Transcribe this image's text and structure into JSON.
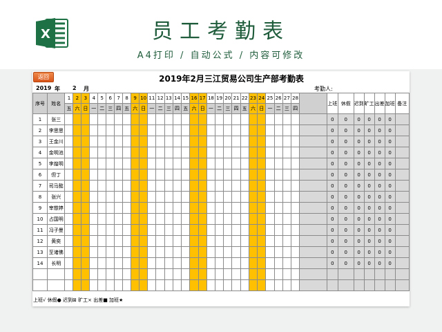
{
  "header": {
    "title": "员工考勤表",
    "subtitle": "A4打印 / 自动公式 / 内容可修改",
    "logo_icon": "excel-icon",
    "logo_color": "#1e7145"
  },
  "sheet": {
    "return_button": "返回",
    "title": "2019年2月三江贸易公司生产部考勤表",
    "year": "2019",
    "year_label": "年",
    "month": "2",
    "month_label": "月",
    "checker_label": "考勤人:",
    "col_no": "序号",
    "col_name": "姓名",
    "days": [
      "1",
      "2",
      "3",
      "4",
      "5",
      "6",
      "7",
      "8",
      "9",
      "10",
      "11",
      "12",
      "13",
      "14",
      "15",
      "16",
      "17",
      "18",
      "19",
      "20",
      "21",
      "22",
      "23",
      "24",
      "25",
      "26",
      "27",
      "28"
    ],
    "weekdays": [
      "五",
      "六",
      "日",
      "一",
      "二",
      "三",
      "四",
      "五",
      "六",
      "日",
      "一",
      "二",
      "三",
      "四",
      "五",
      "六",
      "日",
      "一",
      "二",
      "三",
      "四",
      "五",
      "六",
      "日",
      "一",
      "二",
      "三",
      "四"
    ],
    "weekend_color": "#ffc000",
    "summary_headers": [
      "上班",
      "休假",
      "迟到",
      "旷工",
      "出差",
      "加班",
      "备注"
    ],
    "employees": [
      {
        "no": "1",
        "name": "张三"
      },
      {
        "no": "2",
        "name": "李思思"
      },
      {
        "no": "3",
        "name": "王金川"
      },
      {
        "no": "4",
        "name": "金明池"
      },
      {
        "no": "5",
        "name": "李煌明"
      },
      {
        "no": "6",
        "name": "但丁"
      },
      {
        "no": "7",
        "name": "司马懿"
      },
      {
        "no": "8",
        "name": "张兴"
      },
      {
        "no": "9",
        "name": "宰慈婷"
      },
      {
        "no": "10",
        "name": "占国明"
      },
      {
        "no": "11",
        "name": "冯子曼"
      },
      {
        "no": "12",
        "name": "黄奕"
      },
      {
        "no": "13",
        "name": "至诸佛"
      },
      {
        "no": "14",
        "name": "长明"
      }
    ],
    "zero": "0",
    "legend": "上班√ 休假● 迟到⊠ 旷工× 出差■ 加班★"
  }
}
